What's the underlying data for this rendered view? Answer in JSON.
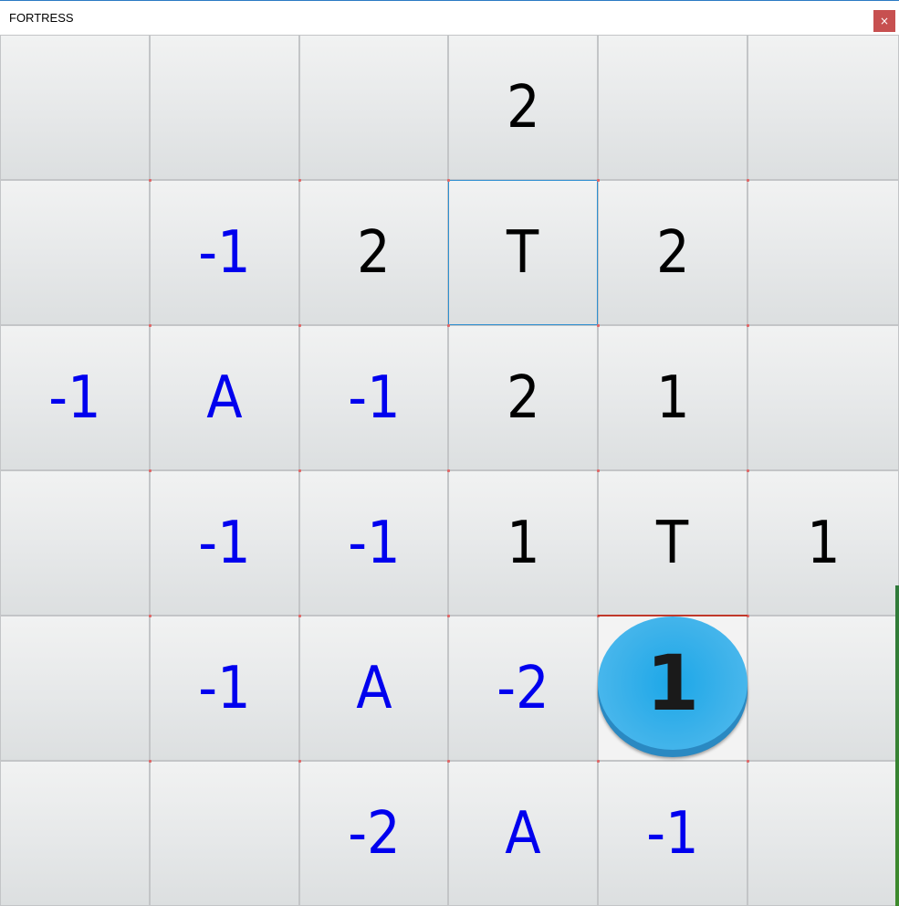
{
  "window": {
    "title": "FORTRESS",
    "close_label": "×"
  },
  "colors": {
    "positive": "#000000",
    "negative": "#0000ee",
    "special": "#0000ee",
    "token_face": "#1ca7e8"
  },
  "board": {
    "rows": 6,
    "cols": 6,
    "cells": [
      [
        "",
        "",
        "",
        "2",
        "",
        ""
      ],
      [
        "",
        "-1",
        "2",
        "T",
        "2",
        ""
      ],
      [
        "-1",
        "A",
        "-1",
        "2",
        "1",
        ""
      ],
      [
        "",
        "-1",
        "-1",
        "1",
        "T",
        "1"
      ],
      [
        "",
        "-1",
        "A",
        "-2",
        "",
        ""
      ],
      [
        "",
        "",
        "-2",
        "A",
        "-1",
        ""
      ]
    ],
    "cell_colors": [
      [
        "pos",
        "pos",
        "pos",
        "pos",
        "pos",
        "pos"
      ],
      [
        "pos",
        "neg",
        "pos",
        "pos",
        "pos",
        "pos"
      ],
      [
        "neg",
        "neg",
        "neg",
        "pos",
        "pos",
        "pos"
      ],
      [
        "pos",
        "neg",
        "neg",
        "pos",
        "pos",
        "pos"
      ],
      [
        "pos",
        "neg",
        "neg",
        "neg",
        "pos",
        "pos"
      ],
      [
        "pos",
        "pos",
        "neg",
        "neg",
        "neg",
        "pos"
      ]
    ],
    "selected_cell": [
      1,
      3
    ],
    "token": {
      "row": 4,
      "col": 4,
      "label": "1"
    }
  }
}
